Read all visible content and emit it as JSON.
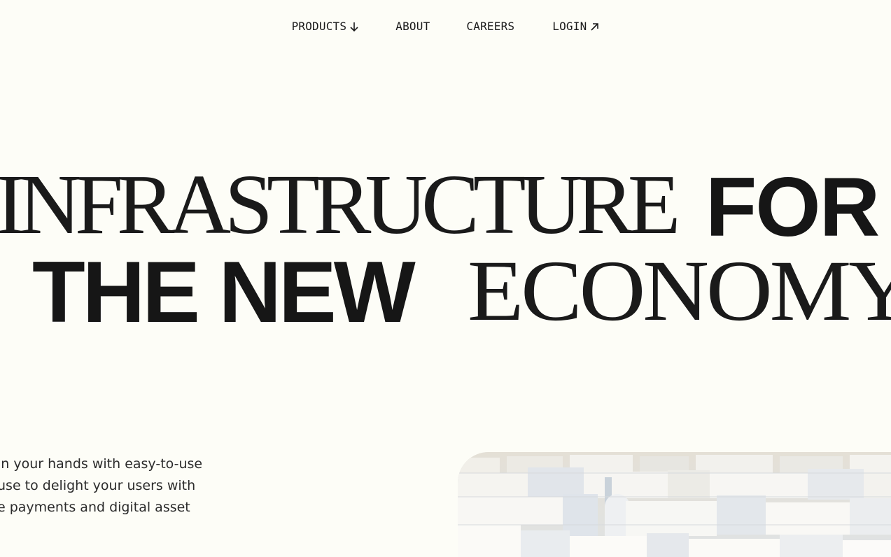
{
  "nav": {
    "items": [
      {
        "label": "PRODUCTS",
        "icon": "arrow-down-icon"
      },
      {
        "label": "ABOUT"
      },
      {
        "label": "CAREERS"
      },
      {
        "label": "LOGIN",
        "icon": "arrow-up-right-icon"
      }
    ]
  },
  "hero": {
    "line1_serif": "INFRASTRUCTURE",
    "line1_sans": "FOR",
    "line2_sans": "THE NEW",
    "line2_serif": "ECONOMY"
  },
  "intro": {
    "lines": [
      "in your hands with easy-to-use",
      "use to delight your users with",
      "e payments and digital asset"
    ]
  },
  "colors": {
    "background": "#fdfdf7",
    "text": "#161616"
  }
}
